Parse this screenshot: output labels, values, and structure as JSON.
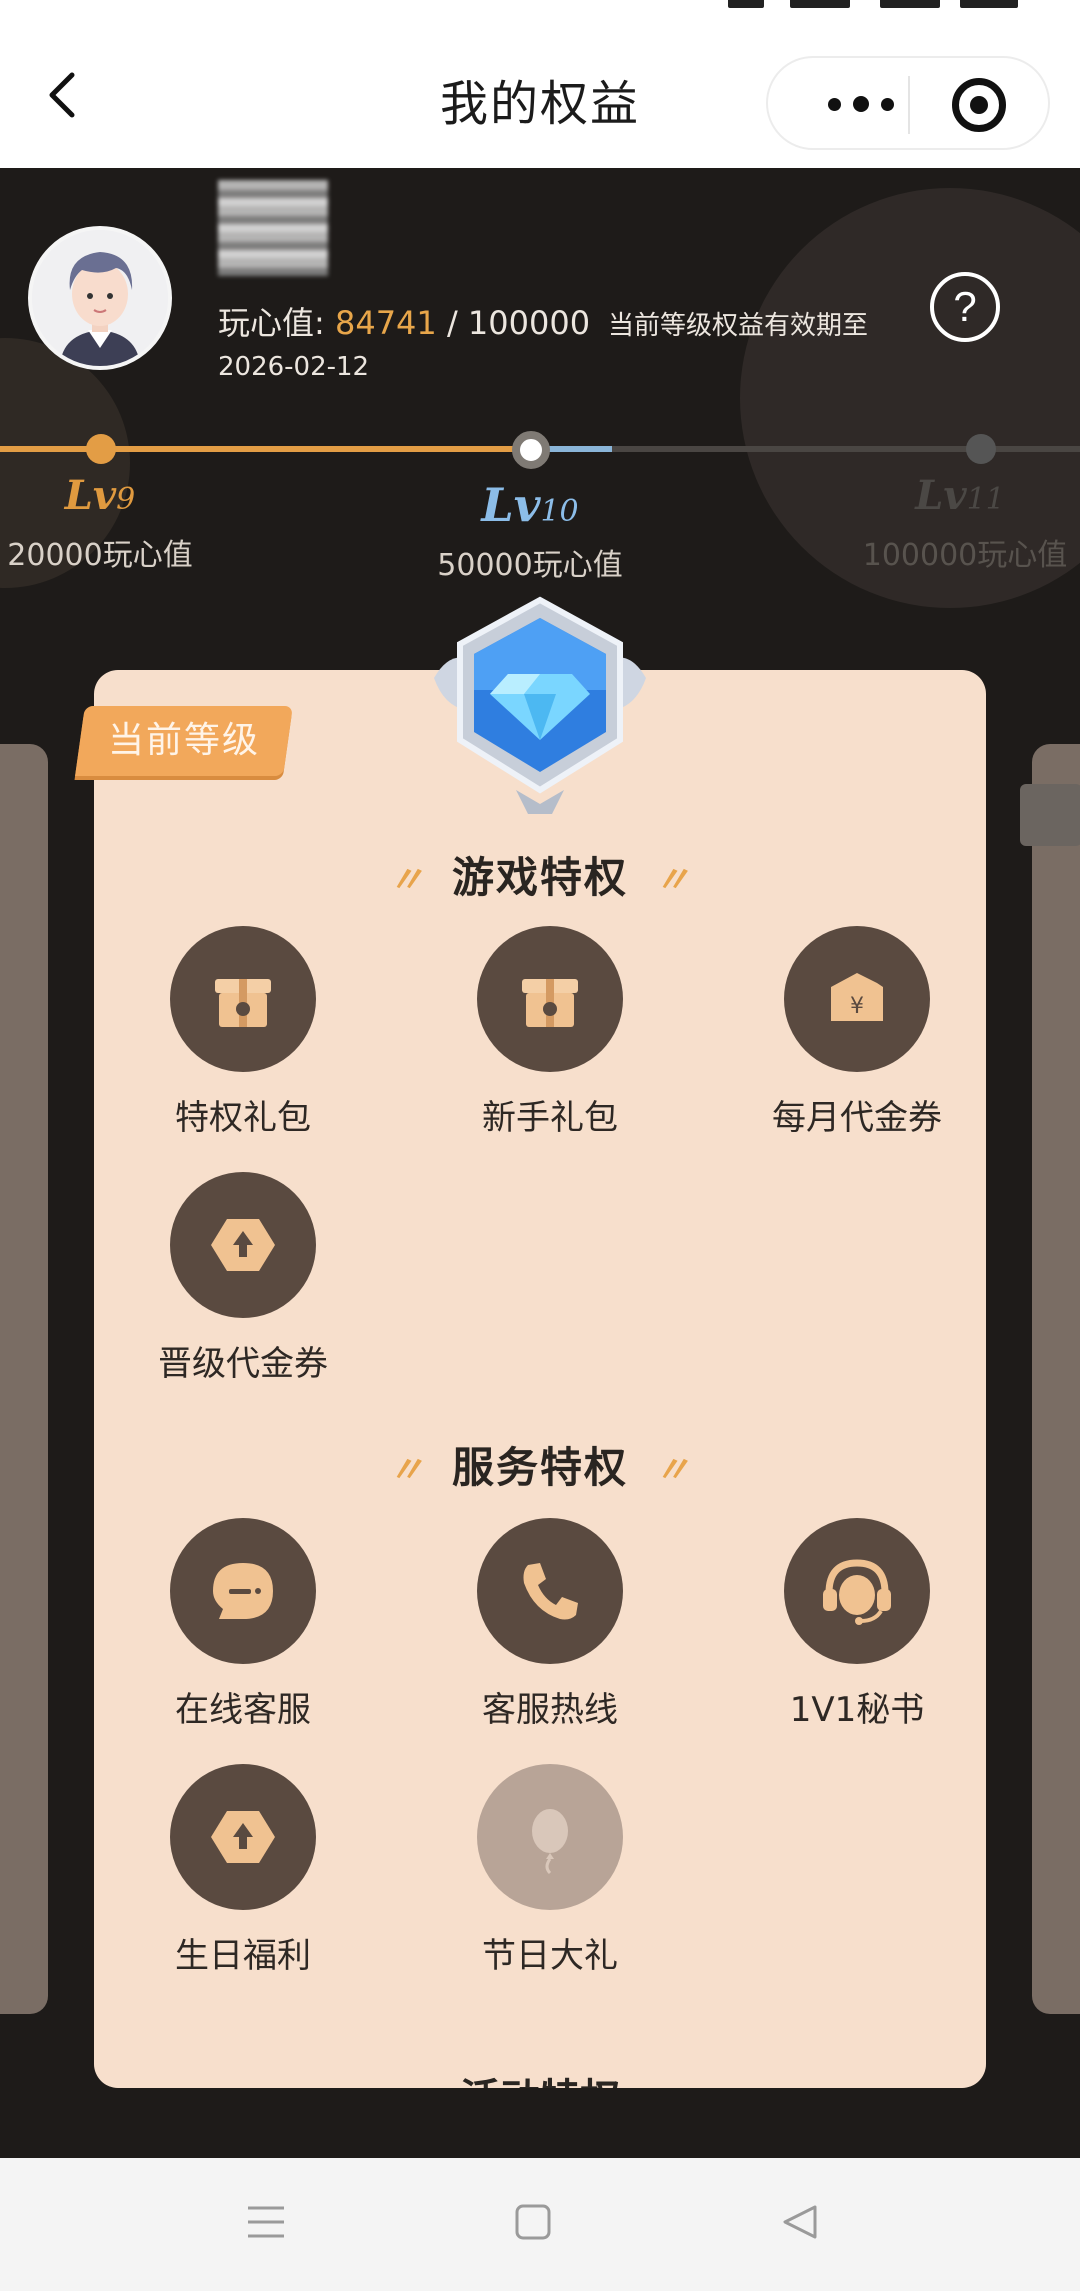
{
  "nav": {
    "title": "我的权益"
  },
  "profile": {
    "points_label": "玩心值: ",
    "points_current": "84741",
    "points_total": " / 100000",
    "validity_note": "当前等级权益有效期至",
    "expire_date": "2026-02-12"
  },
  "levels": [
    {
      "name": "Lv",
      "num": "9",
      "requirement": "20000玩心值",
      "state": "passed"
    },
    {
      "name": "Lv",
      "num": "10",
      "requirement": "50000玩心值",
      "state": "current"
    },
    {
      "name": "Lv",
      "num": "11",
      "requirement": "100000玩心值",
      "state": "locked"
    }
  ],
  "card": {
    "current_tag": "当前等级",
    "game_section": {
      "title": "游戏特权",
      "items": [
        {
          "label": "特权礼包",
          "icon": "gift-box-icon"
        },
        {
          "label": "新手礼包",
          "icon": "gift-box-icon"
        },
        {
          "label": "每月代金券",
          "icon": "voucher-icon"
        },
        {
          "label": "晋级代金券",
          "icon": "upgrade-icon"
        }
      ]
    },
    "service_section": {
      "title": "服务特权",
      "items": [
        {
          "label": "在线客服",
          "icon": "chat-bubble-icon"
        },
        {
          "label": "客服热线",
          "icon": "phone-icon"
        },
        {
          "label": "1V1秘书",
          "icon": "headset-icon"
        },
        {
          "label": "生日福利",
          "icon": "upgrade-icon"
        },
        {
          "label": "节日大礼",
          "icon": "balloon-icon",
          "disabled": true
        }
      ]
    },
    "next_section_title": "活动特权"
  },
  "colors": {
    "accent": "#e39d45",
    "card_bg": "#f7dfcc",
    "icon_bg": "#5a4a40",
    "current_level": "#8cbde8"
  }
}
